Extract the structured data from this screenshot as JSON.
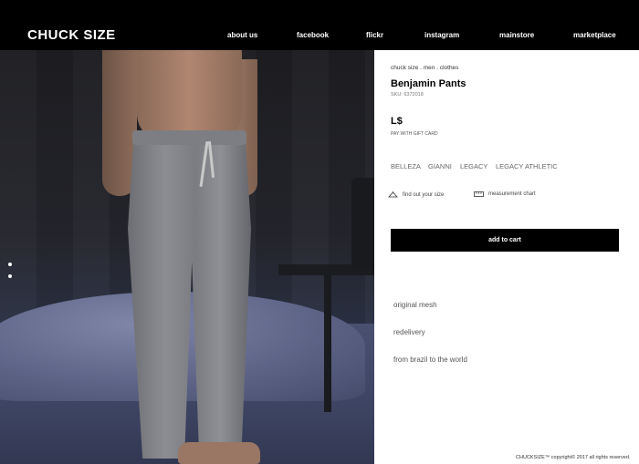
{
  "header": {
    "logo": "CHUCK SIZE",
    "nav": [
      "about us",
      "facebook",
      "flickr",
      "instagram",
      "mainstore",
      "marketplace"
    ]
  },
  "hero": {
    "image_alt": "Model wearing grey sweatpants",
    "slide_count": 2,
    "active_slide": 1
  },
  "product": {
    "breadcrumb": "chuck size . men . clothes",
    "title": "Benjamin Pants",
    "sku": "SKU: 6372018",
    "price": "L$",
    "gift_card": "PAY WITH GIFT CARD",
    "variants": [
      "BELLEZA",
      "GIANNI",
      "LEGACY",
      "LEGACY ATHLETIC"
    ],
    "find_size": "find out your size",
    "measurement_chart": "measurement chart",
    "add_to_cart": "add to cart",
    "features": [
      "original mesh",
      "redelivery",
      "from brazil to the world"
    ]
  },
  "footer": {
    "copyright": "CHUCKSIZE™ copyright© 2017 all rights reserved."
  },
  "colors": {
    "header_bg": "#000000",
    "cart_bg": "#000000",
    "text": "#000000",
    "muted": "#666666"
  }
}
